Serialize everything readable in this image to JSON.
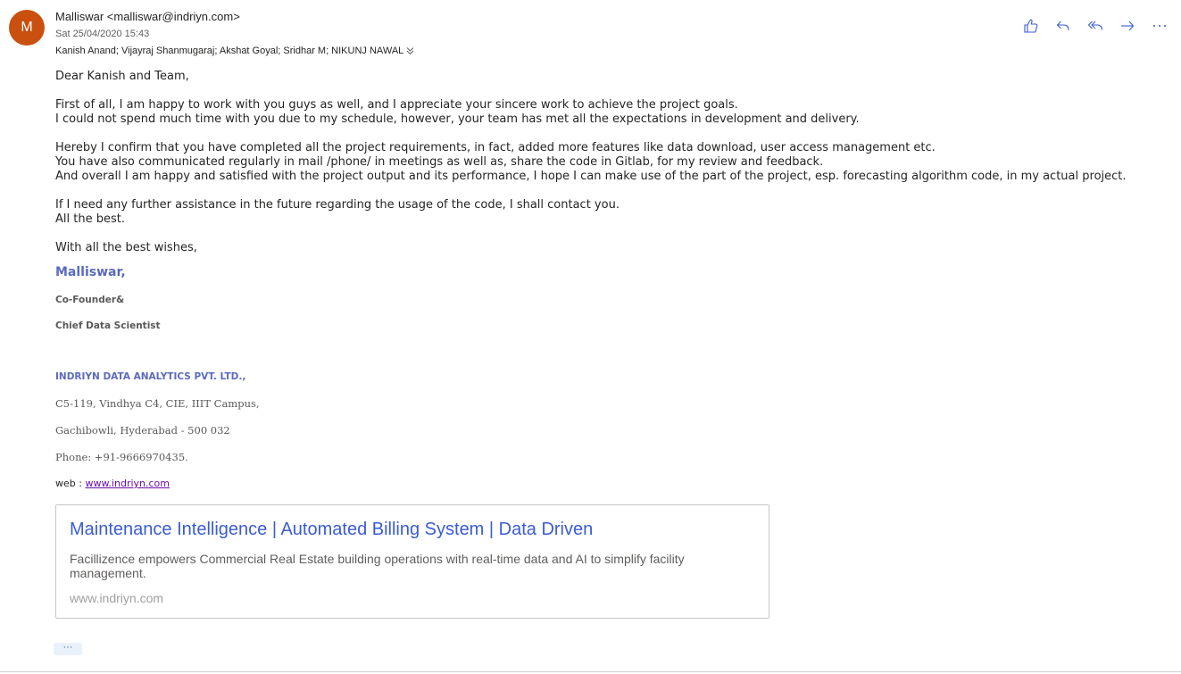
{
  "message": {
    "avatar_initial": "M",
    "avatar_color": "#ca5010",
    "sender": "Malliswar <malliswar@indriyn.com>",
    "date": "Sat 25/04/2020 15:43",
    "recipients": "Kanish Anand; Vijayraj Shanmugaraj; Akshat Goyal; Sridhar M; NIKUNJ NAWAL",
    "actions": [
      {
        "name": "like",
        "icon": "thumbs-up-icon"
      },
      {
        "name": "reply",
        "icon": "reply-icon"
      },
      {
        "name": "reply-all",
        "icon": "reply-all-icon"
      },
      {
        "name": "forward",
        "icon": "forward-icon"
      },
      {
        "name": "more",
        "icon": "more-icon"
      }
    ]
  },
  "body": {
    "greeting": "Dear Kanish and Team,",
    "p1_l1": "First of all, I am happy to work with you guys as well, and I appreciate your sincere work to achieve the project goals.",
    "p1_l2": "I could not spend much time with you due to my schedule, however, your team has met all the expectations in development and delivery.",
    "p2_l1": "Hereby I confirm that you have completed all the project requirements, in fact, added more features like data download, user access management etc.",
    "p2_l2": "You have also communicated regularly in mail /phone/ in meetings as well as, share the code in Gitlab, for my review and feedback.",
    "p2_l3": "And overall I am happy and satisfied with the project output and its performance, I hope I can make use of the part of the project, esp. forecasting algorithm code, in my actual project.",
    "p3_l1": "If I need any further assistance in the future regarding the usage of the code, I shall contact you.",
    "p3_l2": "All the best.",
    "closing": "With all the best wishes,"
  },
  "signature": {
    "name": "Malliswar,",
    "title1": "Co-Founder&",
    "title2": "Chief Data Scientist",
    "company": "INDRIYN DATA ANALYTICS PVT. LTD.,",
    "address1": "C5-119, Vindhya C4, CIE, IIIT Campus,",
    "address2": "Gachibowli, Hyderabad - 500 032",
    "phone": "Phone: +91-9666970435.",
    "web_label": "web : ",
    "web_link": "www.indriyn.com",
    "accent_color": "#5b6abf"
  },
  "link_preview": {
    "title": "Maintenance Intelligence | Automated Billing System | Data Driven",
    "description": "Facillizence empowers Commercial Real Estate building operations with real-time data and AI to simplify facility management.",
    "url": "www.indriyn.com",
    "title_color": "#3b5bd6"
  },
  "footer": {
    "show_more_label": "···"
  }
}
